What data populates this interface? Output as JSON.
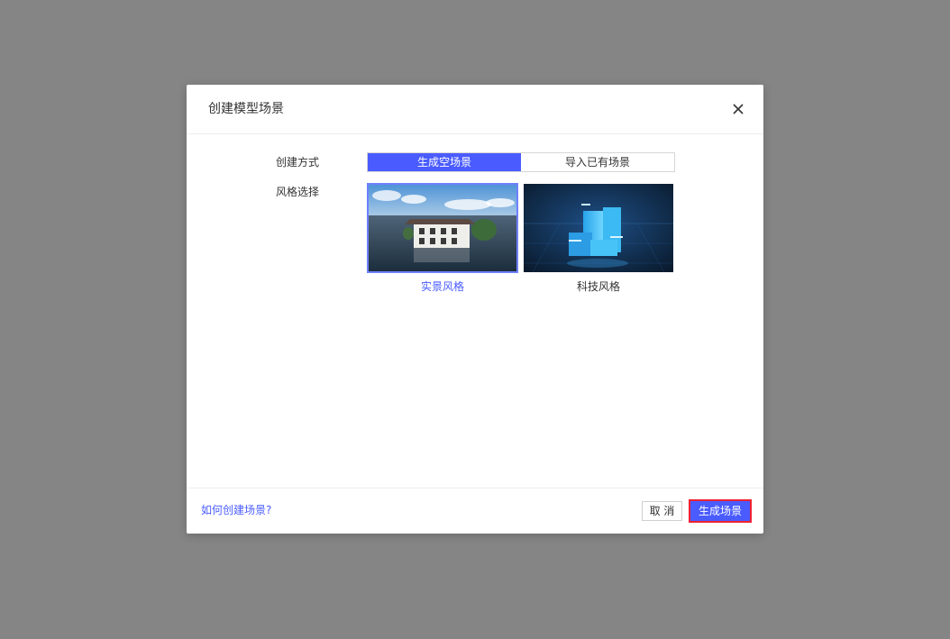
{
  "dialog": {
    "title": "创建模型场景",
    "close_icon": "close-icon"
  },
  "form": {
    "method_label": "创建方式",
    "style_label": "风格选择",
    "methods": [
      {
        "label": "生成空场景",
        "active": true
      },
      {
        "label": "导入已有场景",
        "active": false
      }
    ],
    "styles": [
      {
        "label": "实景风格",
        "selected": true
      },
      {
        "label": "科技风格",
        "selected": false
      }
    ]
  },
  "footer": {
    "help_link": "如何创建场景?",
    "cancel_label": "取 消",
    "confirm_label": "生成场景"
  },
  "colors": {
    "accent": "#4a5cff",
    "overlay": "#858585",
    "highlight_border": "#ee2233"
  }
}
